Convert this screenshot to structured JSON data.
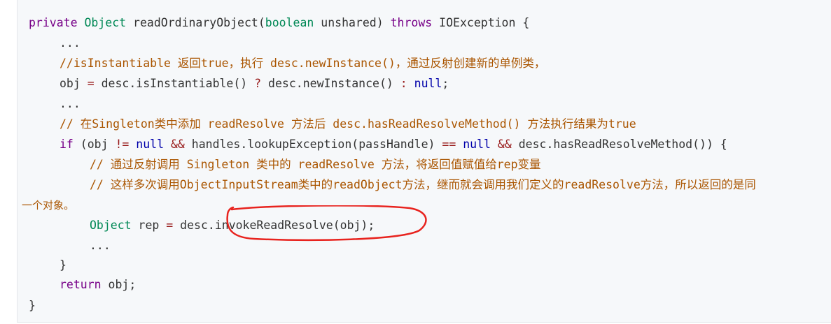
{
  "code": {
    "line1": {
      "kw_private": "private",
      "type_object": "Object",
      "sig": " readOrdinaryObject(",
      "kw_boolean": "boolean",
      "param": " unshared) ",
      "kw_throws": "throws",
      "rest": " IOException {"
    },
    "line2": "...",
    "line3": "//isInstantiable 返回true，执行 desc.newInstance()，通过反射创建新的单例类，",
    "line4": {
      "pre": "obj ",
      "eq": "=",
      "mid": " desc.isInstantiable() ",
      "q": "?",
      "mid2": " desc.newInstance() ",
      "colon": ":",
      "sp": " ",
      "null": "null",
      "end": ";"
    },
    "line5": "...",
    "line6": "// 在Singleton类中添加 readResolve 方法后 desc.hasReadResolveMethod() 方法执行结果为true",
    "line7": {
      "kw_if": "if",
      "a": " (obj ",
      "neq": "!=",
      "sp1": " ",
      "null1": "null",
      "sp2": " ",
      "and1": "&&",
      "b": " handles.lookupException(passHandle) ",
      "eqeq": "==",
      "sp3": " ",
      "null2": "null",
      "sp4": " ",
      "and2": "&&",
      "c": " desc.hasReadResolveMethod()) {"
    },
    "line8": "// 通过反射调用 Singleton 类中的 readResolve 方法，将返回值赋值给rep变量",
    "line9": "// 这样多次调用ObjectInputStream类中的readObject方法，继而就会调用我们定义的readResolve方法，所以返回的是同",
    "line10": "一个对象。",
    "line11": {
      "type_object": "Object",
      "a": " rep ",
      "eq": "=",
      "b": " desc.invokeReadResolve(obj);"
    },
    "line12": "...",
    "line13": "}",
    "line14": {
      "kw_return": "return",
      "rest": " obj;"
    },
    "line15": "}"
  },
  "colors": {
    "keyword": "#770088",
    "type": "#008855",
    "literal": "#0000aa",
    "operator": "#981a1a",
    "comment": "#aa5500",
    "annotation": "#e8231e"
  }
}
